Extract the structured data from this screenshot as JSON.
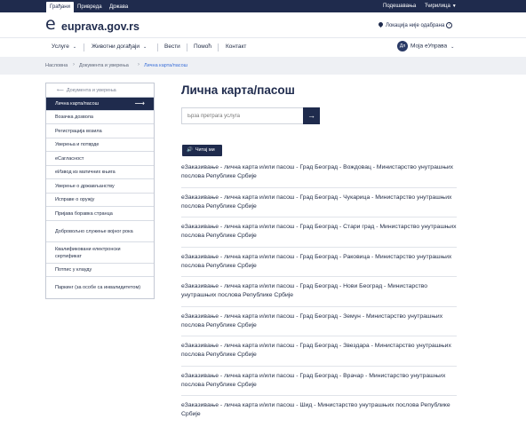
{
  "topbar": {
    "tabs": [
      "Грађани",
      "Привреда",
      "Држава"
    ],
    "register": "Подешавања",
    "language": "Ћирилица"
  },
  "header": {
    "logo_mark": "e",
    "logo_text": "euprava.gov.rs",
    "location": "Локација није одабрана",
    "help": "?"
  },
  "nav": {
    "items": [
      "Услуге",
      "Животни догађаји",
      "Вести",
      "Помоћ",
      "Контакт"
    ],
    "my_euprava": "Моја еУправа",
    "avatar_initials": "Дл"
  },
  "breadcrumb": [
    "Насловна",
    "Документа и уверења",
    "Лична карта/пасош"
  ],
  "sidebar": {
    "back_label": "Документа и уверења",
    "items": [
      "Лична карта/пасош",
      "Возачка дозвола",
      "Регистрација возила",
      "Уверења и потврде",
      "еСагласност",
      "еИзвод из матичних књига",
      "Уверење о држављанству",
      "Исправе о оружју",
      "Пријава боравка странца",
      "Добровољно служење војног рока",
      "Квалификовани електронски сертификат",
      "Потпис у клауду",
      "Паркинг (за особе са инвалидитетом)"
    ]
  },
  "main": {
    "title": "Лична карта/пасош",
    "search_placeholder": "Брза претрага услуга",
    "read_button": "Читај ми",
    "results": [
      "еЗаказивање - лична карта и/или пасош - Град Београд - Вождовац - Министарство унутрашњих послова Републике Србије",
      "еЗаказивање - лична карта и/или пасош - Град Београд - Чукарица - Министарство унутрашњих послова Републике Србије",
      "еЗаказивање - лична карта и/или пасош - Град Београд - Стари град - Министарство унутрашњих послова Републике Србије",
      "еЗаказивање - лична карта и/или пасош - Град Београд - Раковица - Министарство унутрашњих послова Републике Србије",
      "еЗаказивање - лична карта и/или пасош - Град Београд - Нови Београд - Министарство унутрашњих послова Републике Србије",
      "еЗаказивање - лична карта и/или пасош - Град Београд - Земун - Министарство унутрашњих послова Републике Србије",
      "еЗаказивање - лична карта и/или пасош - Град Београд - Звездара - Министарство унутрашњих послова Републике Србије",
      "еЗаказивање - лична карта и/или пасош - Град Београд - Врачар - Министарство унутрашњих послова Републике Србије",
      "еЗаказивање - лична карта и/или пасош - Шид - Министарство унутрашњих послова Републике Србије"
    ]
  }
}
